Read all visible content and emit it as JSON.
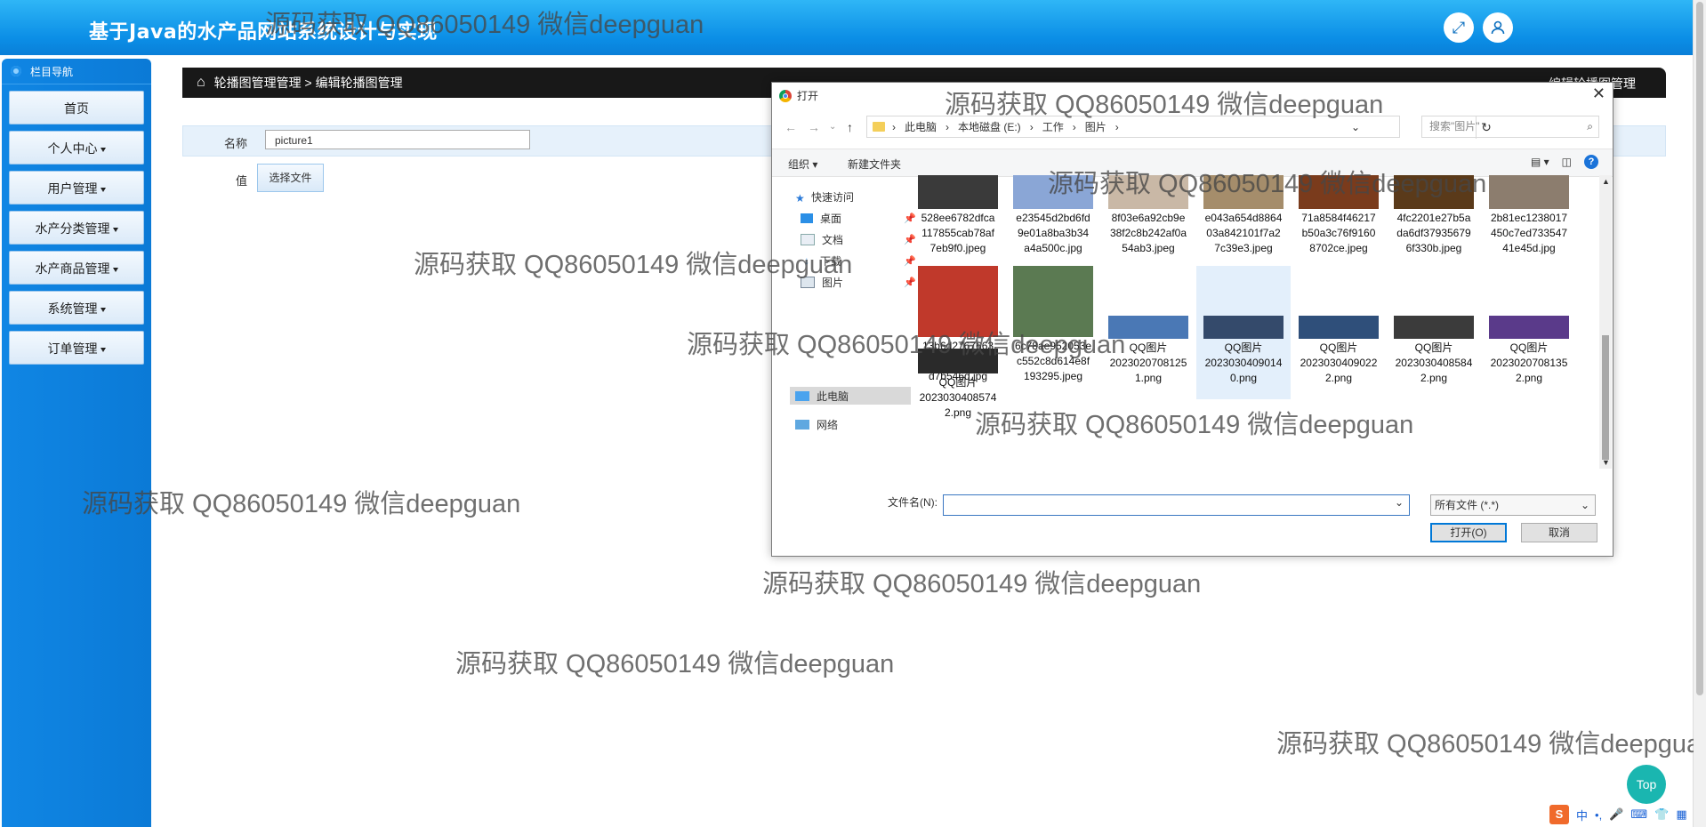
{
  "header": {
    "title": "基于Java的水产品网站系统设计与实现",
    "icons": [
      "fullscreen-icon",
      "user-icon"
    ]
  },
  "sidebar": {
    "heading": "栏目导航",
    "items": [
      {
        "label": "首页",
        "dropdown": false
      },
      {
        "label": "个人中心",
        "dropdown": true
      },
      {
        "label": "用户管理",
        "dropdown": true
      },
      {
        "label": "水产分类管理",
        "dropdown": true
      },
      {
        "label": "水产商品管理",
        "dropdown": true
      },
      {
        "label": "系统管理",
        "dropdown": true
      },
      {
        "label": "订单管理",
        "dropdown": true
      }
    ]
  },
  "breadcrumb": {
    "path": "轮播图管理管理 > 编辑轮播图管理",
    "right": "编辑轮播图管理"
  },
  "form": {
    "name_label": "名称",
    "name_value": "picture1",
    "value_label": "值",
    "choose_file": "选择文件"
  },
  "dialog": {
    "title": "打开",
    "address": [
      "此电脑",
      "本地磁盘 (E:)",
      "工作",
      "图片"
    ],
    "search_placeholder": "搜索\"图片\"",
    "toolbar": {
      "organize": "组织",
      "new_folder": "新建文件夹"
    },
    "tree": {
      "quick_access": "快速访问",
      "desktop": "桌面",
      "documents": "文档",
      "downloads": "下载",
      "pictures": "图片",
      "this_pc": "此电脑",
      "network": "网络"
    },
    "files": [
      {
        "name": "528ee6782dfca117855cab78af7eb9f0.jpeg",
        "lines": [
          "528ee6782dfca",
          "117855cab78af",
          "7eb9f0.jpeg"
        ],
        "thumb": "#3a3a3a"
      },
      {
        "name": "e23545d2bd6fd9e01a8ba3b34a4a500c.jpg",
        "lines": [
          "e23545d2bd6fd",
          "9e01a8ba3b34",
          "a4a500c.jpg"
        ],
        "thumb": "#8aa6d6"
      },
      {
        "name": "8f03e6a92cb9e38f2c8b242af0a54ab3.jpeg",
        "lines": [
          "8f03e6a92cb9e",
          "38f2c8b242af0a",
          "54ab3.jpeg"
        ],
        "thumb": "#c9b8a6"
      },
      {
        "name": "e043a654d886403a842101f7a27c39e3.jpeg",
        "lines": [
          "e043a654d8864",
          "03a842101f7a2",
          "7c39e3.jpeg"
        ],
        "thumb": "#a58d6b"
      },
      {
        "name": "71a8584f46217b50a3c76f91608702ce.jpeg",
        "lines": [
          "71a8584f46217",
          "b50a3c76f9160",
          "8702ce.jpeg"
        ],
        "thumb": "#7a3b1c"
      },
      {
        "name": "4fc2201e27b5ada6df379356796f330b.jpeg",
        "lines": [
          "4fc2201e27b5a",
          "da6df37935679",
          "6f330b.jpeg"
        ],
        "thumb": "#5a3a1a"
      },
      {
        "name": "2b81ec1238017450c7ed73354741e45d.jpg",
        "lines": [
          "2b81ec1238017",
          "450c7ed733547",
          "41e45d.jpg"
        ],
        "thumb": "#8c7d6e"
      },
      {
        "name": "13b6d27676636a9cdcc6b8956d7b546d.jpg",
        "lines": [
          "13b6d2767663",
          "6a9cdcc6b8956",
          "d7b546d.jpg"
        ],
        "thumb": "#c0392b"
      },
      {
        "name": "6c78ae952053ec552c8d614e8f193295.jpeg",
        "lines": [
          "6c78ae952053e",
          "c552c8d614e8f",
          "193295.jpeg"
        ],
        "thumb": "#5b7a52"
      },
      {
        "name": "QQ图片20230207081251.png",
        "lines": [
          "QQ图片",
          "2023020708125",
          "1.png"
        ],
        "thumb": "#4a78b5"
      },
      {
        "name": "QQ图片20230304090140.png",
        "lines": [
          "QQ图片",
          "2023030409014",
          "0.png"
        ],
        "thumb": "#344a6b",
        "selected": true
      },
      {
        "name": "QQ图片20230304090222.png",
        "lines": [
          "QQ图片",
          "2023030409022",
          "2.png"
        ],
        "thumb": "#2f4f7a"
      },
      {
        "name": "QQ图片20230304085842.png",
        "lines": [
          "QQ图片",
          "2023030408584",
          "2.png"
        ],
        "thumb": "#3b3b3b"
      },
      {
        "name": "QQ图片20230207081352.png",
        "lines": [
          "QQ图片",
          "2023020708135",
          "2.png"
        ],
        "thumb": "#5a3a8a"
      },
      {
        "name": "QQ图片20230304085742.png",
        "lines": [
          "QQ图片",
          "2023030408574",
          "2.png"
        ],
        "thumb": "#2a2a2a"
      }
    ],
    "filename_label": "文件名(N):",
    "filename_value": "",
    "filetype": "所有文件 (*.*)",
    "open": "打开(O)",
    "cancel": "取消"
  },
  "watermark": "源码获取 QQ86050149 微信deepguan",
  "top_button": "Top",
  "ime": {
    "logo": "S",
    "mode": "中"
  }
}
